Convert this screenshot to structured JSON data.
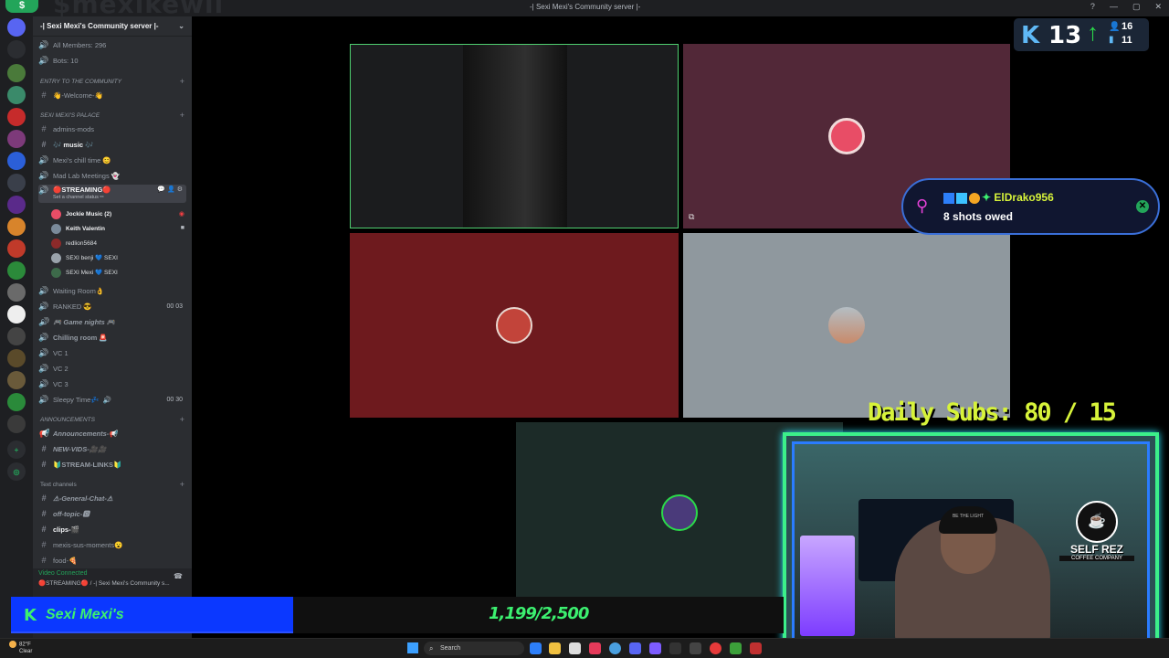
{
  "window": {
    "title": "-| Sexi Mexi's Community server |-",
    "overlay_name": "$mexikewii",
    "badge": "$",
    "ctrl_help": "?",
    "ctrl_min": "—",
    "ctrl_max": "▢",
    "ctrl_close": "✕"
  },
  "server": {
    "name": "-| Sexi Mexi's Community server |-",
    "all_members": "All Members: 296",
    "bots": "Bots: 10"
  },
  "categories": {
    "entry": "ENTRY TO THE COMMUNITY",
    "palace": "SEXI MEXI'S PALACE",
    "announcements": "ANNOUNCEMENTS",
    "text": "Text channels"
  },
  "channels": {
    "welcome": "👋-Welcome-👋",
    "admins": "admins-mods",
    "music": "🎶 music 🎶",
    "chill": "Mexi's chill time 😊",
    "madlab": "Mad Lab Meetings 👻",
    "streaming": "🔴STREAMING🔴",
    "streaming_status": "Set a channel status ✏",
    "waiting": "Waiting Room👌",
    "ranked": "RANKED 😎",
    "ranked_count": "00  03",
    "game_nights": "🎮 Game nights 🎮",
    "chilling": "Chilling room 🚨",
    "vc1": "VC 1",
    "vc2": "VC 2",
    "vc3": "VC 3",
    "sleepy": "Sleepy Time💤",
    "sleepy_count": "00  30",
    "announcements": "Announcements-📢",
    "new_vids": "NEW-VIDS-🎥🎥",
    "stream_links": "🔰STREAM-LINKS🔰",
    "general": "⚠-General-Chat-⚠",
    "off_topic": "off-topic-🅾",
    "clips": "clips-🎬",
    "sus": "mexis-sus-moments😮",
    "food": "food-🍕"
  },
  "voice_users": [
    {
      "name": "Jockie Music (2)",
      "color": "#e84d66"
    },
    {
      "name": "Keith Valentin",
      "color": "#7a8a9a"
    },
    {
      "name": "redlion5684",
      "color": "#8c2a2a"
    },
    {
      "name": "SEXI benji 💙 SEXI",
      "color": "#9aa3ab"
    },
    {
      "name": "SEXI Mexi 💙 SEXI",
      "color": "#3d6a4a"
    }
  ],
  "voice_panel": {
    "status": "Video Connected",
    "channel": "🔴STREAMING🔴 / -| Sexi Mexi's Community s..."
  },
  "stats": {
    "logo": "K",
    "count": "13",
    "arrow": "↑",
    "stat_a": "16",
    "stat_b": "11"
  },
  "alert": {
    "user": "ElDrako956",
    "message": "8 shots owed",
    "close": "✕"
  },
  "daily_subs": "Daily Subs:  80 / 15",
  "sponsor": {
    "name": "SELF REZ",
    "sub": "COFFEE COMPANY",
    "cap_text": "BE THE LIGHT"
  },
  "goal": {
    "logo": "K",
    "name": "Sexi Mexi's",
    "progress": "1,199/2,500",
    "fraction": 0.48
  },
  "taskbar": {
    "temp": "82°F",
    "condition": "Clear",
    "search": "Search"
  }
}
